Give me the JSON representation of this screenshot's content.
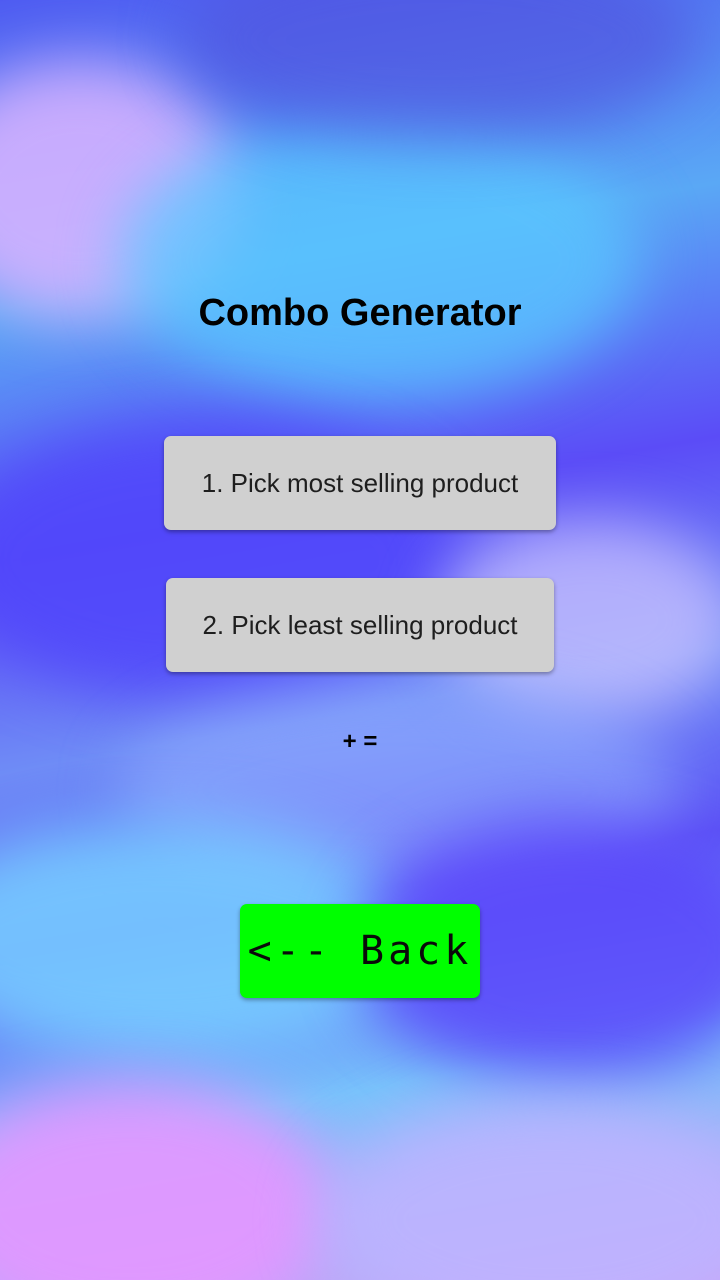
{
  "screen": {
    "title": "Combo Generator",
    "pick_most_label": "1. Pick most selling product",
    "pick_least_label": "2. Pick least selling product",
    "combo_result": "+ =",
    "back_label": "<-- Back"
  },
  "colors": {
    "button_bg": "#d0d0d0",
    "back_button_bg": "#00ff00",
    "text": "#000000"
  }
}
